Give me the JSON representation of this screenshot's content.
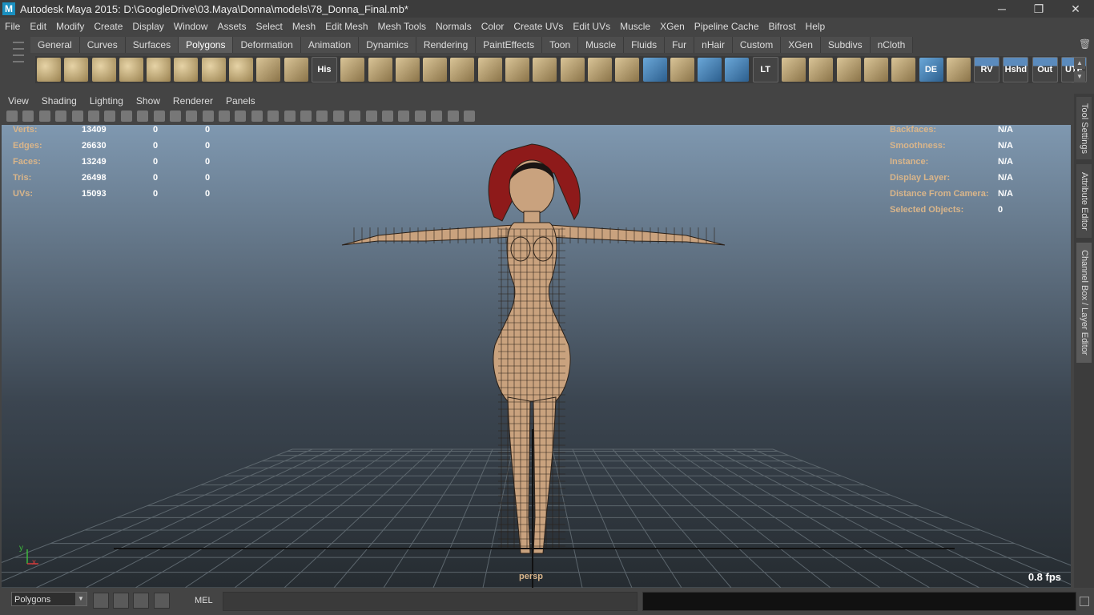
{
  "window": {
    "title": "Autodesk Maya 2015: D:\\GoogleDrive\\03.Maya\\Donna\\models\\78_Donna_Final.mb*",
    "icon_label": "M",
    "controls": [
      "─",
      "❐",
      "✕"
    ]
  },
  "menubar": [
    "File",
    "Edit",
    "Modify",
    "Create",
    "Display",
    "Window",
    "Assets",
    "Select",
    "Mesh",
    "Edit Mesh",
    "Mesh Tools",
    "Normals",
    "Color",
    "Create UVs",
    "Edit UVs",
    "Muscle",
    "XGen",
    "Pipeline Cache",
    "Bifrost",
    "Help"
  ],
  "shelf": {
    "tabs": [
      "General",
      "Curves",
      "Surfaces",
      "Polygons",
      "Deformation",
      "Animation",
      "Dynamics",
      "Rendering",
      "PaintEffects",
      "Toon",
      "Muscle",
      "Fluids",
      "Fur",
      "nHair",
      "Custom",
      "XGen",
      "Subdivs",
      "nCloth"
    ],
    "active_tab": "Polygons",
    "icons": [
      {
        "name": "poly-sphere-icon",
        "style": "prim",
        "label": ""
      },
      {
        "name": "poly-cube-icon",
        "style": "prim",
        "label": ""
      },
      {
        "name": "poly-cylinder-icon",
        "style": "prim",
        "label": ""
      },
      {
        "name": "poly-cone-icon",
        "style": "prim",
        "label": ""
      },
      {
        "name": "poly-plane-icon",
        "style": "prim",
        "label": ""
      },
      {
        "name": "poly-torus-icon",
        "style": "prim",
        "label": ""
      },
      {
        "name": "poly-pyramid-icon",
        "style": "prim",
        "label": ""
      },
      {
        "name": "poly-pipe-icon",
        "style": "prim",
        "label": ""
      },
      {
        "name": "create-polygon-icon",
        "style": "tool",
        "label": ""
      },
      {
        "name": "sculpt-icon",
        "style": "tool",
        "label": ""
      },
      {
        "name": "history-icon",
        "style": "txt",
        "label": "His"
      },
      {
        "name": "extrude-icon",
        "style": "tool",
        "label": ""
      },
      {
        "name": "bevel-icon",
        "style": "tool",
        "label": ""
      },
      {
        "name": "bridge-icon",
        "style": "tool",
        "label": ""
      },
      {
        "name": "append-icon",
        "style": "tool",
        "label": ""
      },
      {
        "name": "split-icon",
        "style": "tool",
        "label": ""
      },
      {
        "name": "insert-loop-icon",
        "style": "tool",
        "label": ""
      },
      {
        "name": "merge-icon",
        "style": "tool",
        "label": ""
      },
      {
        "name": "combine-icon",
        "style": "tool",
        "label": ""
      },
      {
        "name": "separate-icon",
        "style": "tool",
        "label": ""
      },
      {
        "name": "fill-hole-icon",
        "style": "tool",
        "label": ""
      },
      {
        "name": "paint-select-icon",
        "style": "tool",
        "label": ""
      },
      {
        "name": "mesh-display-icon",
        "style": "blue",
        "label": ""
      },
      {
        "name": "target-weld-icon",
        "style": "tool",
        "label": ""
      },
      {
        "name": "transform-component-icon",
        "style": "blue",
        "label": ""
      },
      {
        "name": "lattice-icon",
        "style": "blue",
        "label": ""
      },
      {
        "name": "lt-icon",
        "style": "txt",
        "label": "LT"
      },
      {
        "name": "uv-layout-icon",
        "style": "tool",
        "label": ""
      },
      {
        "name": "uv-unfold-icon",
        "style": "tool",
        "label": ""
      },
      {
        "name": "uv-planar-icon",
        "style": "tool",
        "label": ""
      },
      {
        "name": "uv-cylindrical-icon",
        "style": "tool",
        "label": ""
      },
      {
        "name": "uv-spherical-icon",
        "style": "tool",
        "label": ""
      },
      {
        "name": "de-icon",
        "style": "blue",
        "label": "DE"
      },
      {
        "name": "uv-auto-icon",
        "style": "tool",
        "label": ""
      },
      {
        "name": "rv-icon",
        "style": "txtblue",
        "label": "RV"
      },
      {
        "name": "hshd-icon",
        "style": "txtblue",
        "label": "Hshd"
      },
      {
        "name": "out-icon",
        "style": "txtblue",
        "label": "Out"
      },
      {
        "name": "ute-icon",
        "style": "txtblue",
        "label": "UTE"
      }
    ]
  },
  "panel_menu": [
    "View",
    "Shading",
    "Lighting",
    "Show",
    "Renderer",
    "Panels"
  ],
  "hud_left": [
    {
      "label": "Verts:",
      "v1": "13409",
      "v2": "0",
      "v3": "0"
    },
    {
      "label": "Edges:",
      "v1": "26630",
      "v2": "0",
      "v3": "0"
    },
    {
      "label": "Faces:",
      "v1": "13249",
      "v2": "0",
      "v3": "0"
    },
    {
      "label": "Tris:",
      "v1": "26498",
      "v2": "0",
      "v3": "0"
    },
    {
      "label": "UVs:",
      "v1": "15093",
      "v2": "0",
      "v3": "0"
    }
  ],
  "hud_right": [
    {
      "label": "Backfaces:",
      "value": "N/A"
    },
    {
      "label": "Smoothness:",
      "value": "N/A"
    },
    {
      "label": "Instance:",
      "value": "N/A"
    },
    {
      "label": "Display Layer:",
      "value": "N/A"
    },
    {
      "label": "Distance From Camera:",
      "value": "N/A"
    },
    {
      "label": "Selected Objects:",
      "value": "0"
    }
  ],
  "viewport": {
    "camera": "persp",
    "fps": "0.8 fps",
    "axis_y": "y",
    "axis_x": "x",
    "colors": {
      "skin": "#c9a27e",
      "wire": "#2a2018",
      "hair": "#8e1a1a",
      "grid": "#5c666d"
    }
  },
  "side_tabs": [
    "Tool Settings",
    "Attribute Editor",
    "Channel Box / Layer Editor"
  ],
  "bottom": {
    "mode": "Polygons",
    "mel_label": "MEL"
  }
}
